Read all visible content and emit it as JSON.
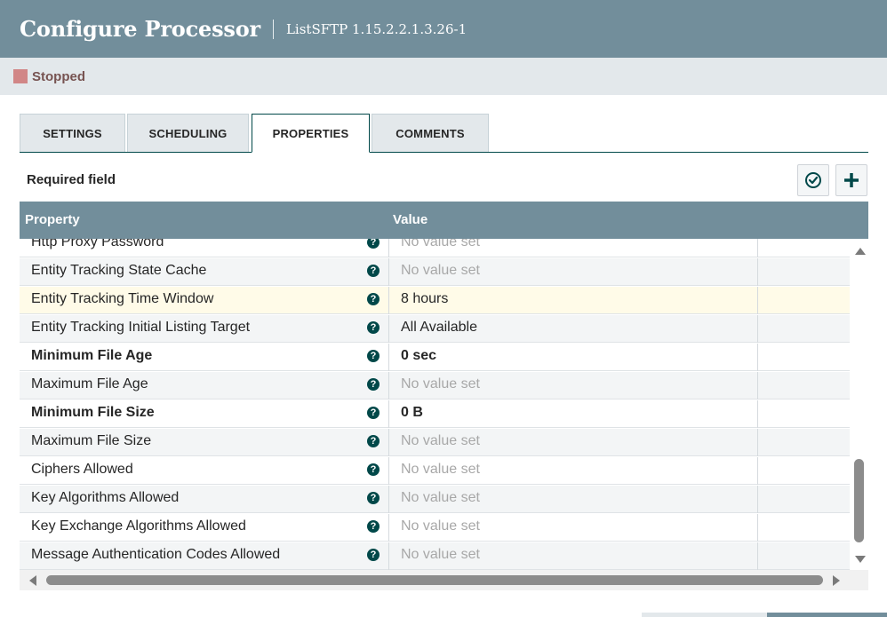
{
  "header": {
    "title": "Configure Processor",
    "subtitle": "ListSFTP 1.15.2.2.1.3.26-1"
  },
  "status": {
    "text": "Stopped",
    "color": "#d18686"
  },
  "tabs": [
    {
      "label": "SETTINGS",
      "active": false
    },
    {
      "label": "SCHEDULING",
      "active": false
    },
    {
      "label": "PROPERTIES",
      "active": true
    },
    {
      "label": "COMMENTS",
      "active": false
    }
  ],
  "properties_panel": {
    "required_label": "Required field",
    "verify_icon": "check-circle-icon",
    "add_icon": "plus-icon",
    "columns": {
      "property": "Property",
      "value": "Value"
    },
    "rows": [
      {
        "name": "Http Proxy Password",
        "value": "No value set",
        "required": false,
        "empty": true
      },
      {
        "name": "Entity Tracking State Cache",
        "value": "No value set",
        "required": false,
        "empty": true
      },
      {
        "name": "Entity Tracking Time Window",
        "value": "8 hours",
        "required": false,
        "empty": false,
        "selected": true
      },
      {
        "name": "Entity Tracking Initial Listing Target",
        "value": "All Available",
        "required": false,
        "empty": false
      },
      {
        "name": "Minimum File Age",
        "value": "0 sec",
        "required": true,
        "empty": false
      },
      {
        "name": "Maximum File Age",
        "value": "No value set",
        "required": false,
        "empty": true
      },
      {
        "name": "Minimum File Size",
        "value": "0 B",
        "required": true,
        "empty": false
      },
      {
        "name": "Maximum File Size",
        "value": "No value set",
        "required": false,
        "empty": true
      },
      {
        "name": "Ciphers Allowed",
        "value": "No value set",
        "required": false,
        "empty": true
      },
      {
        "name": "Key Algorithms Allowed",
        "value": "No value set",
        "required": false,
        "empty": true
      },
      {
        "name": "Key Exchange Algorithms Allowed",
        "value": "No value set",
        "required": false,
        "empty": true
      },
      {
        "name": "Message Authentication Codes Allowed",
        "value": "No value set",
        "required": false,
        "empty": true
      }
    ]
  },
  "colors": {
    "header": "#728e9b",
    "accent": "#004849",
    "selected_row": "#fffbe8"
  }
}
